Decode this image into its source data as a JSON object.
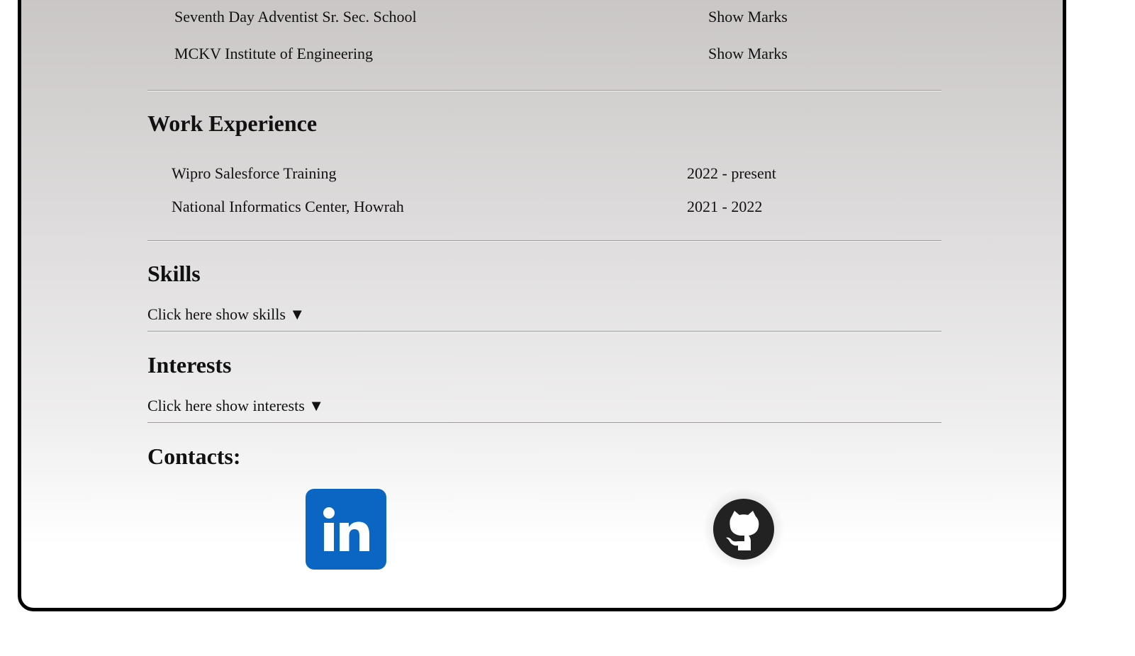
{
  "education": {
    "items": [
      {
        "name": "Seventh Day Adventist Sr. Sec. School",
        "action": "Show Marks"
      },
      {
        "name": "MCKV Institute of Engineering",
        "action": "Show Marks"
      }
    ]
  },
  "work": {
    "title": "Work Experience",
    "items": [
      {
        "name": "Wipro Salesforce Training",
        "period": "2022 - present"
      },
      {
        "name": "National Informatics Center, Howrah",
        "period": "2021 - 2022"
      }
    ]
  },
  "skills": {
    "title": "Skills",
    "toggle_label": "Click here show skills ▼"
  },
  "interests": {
    "title": "Interests",
    "toggle_label": "Click here show interests ▼"
  },
  "contacts": {
    "title": "Contacts:",
    "linkedin": {
      "icon": "linkedin-icon",
      "brand_color": "#0a66c2",
      "text": "in"
    },
    "github": {
      "icon": "github-icon",
      "brand_color": "#222222"
    }
  }
}
